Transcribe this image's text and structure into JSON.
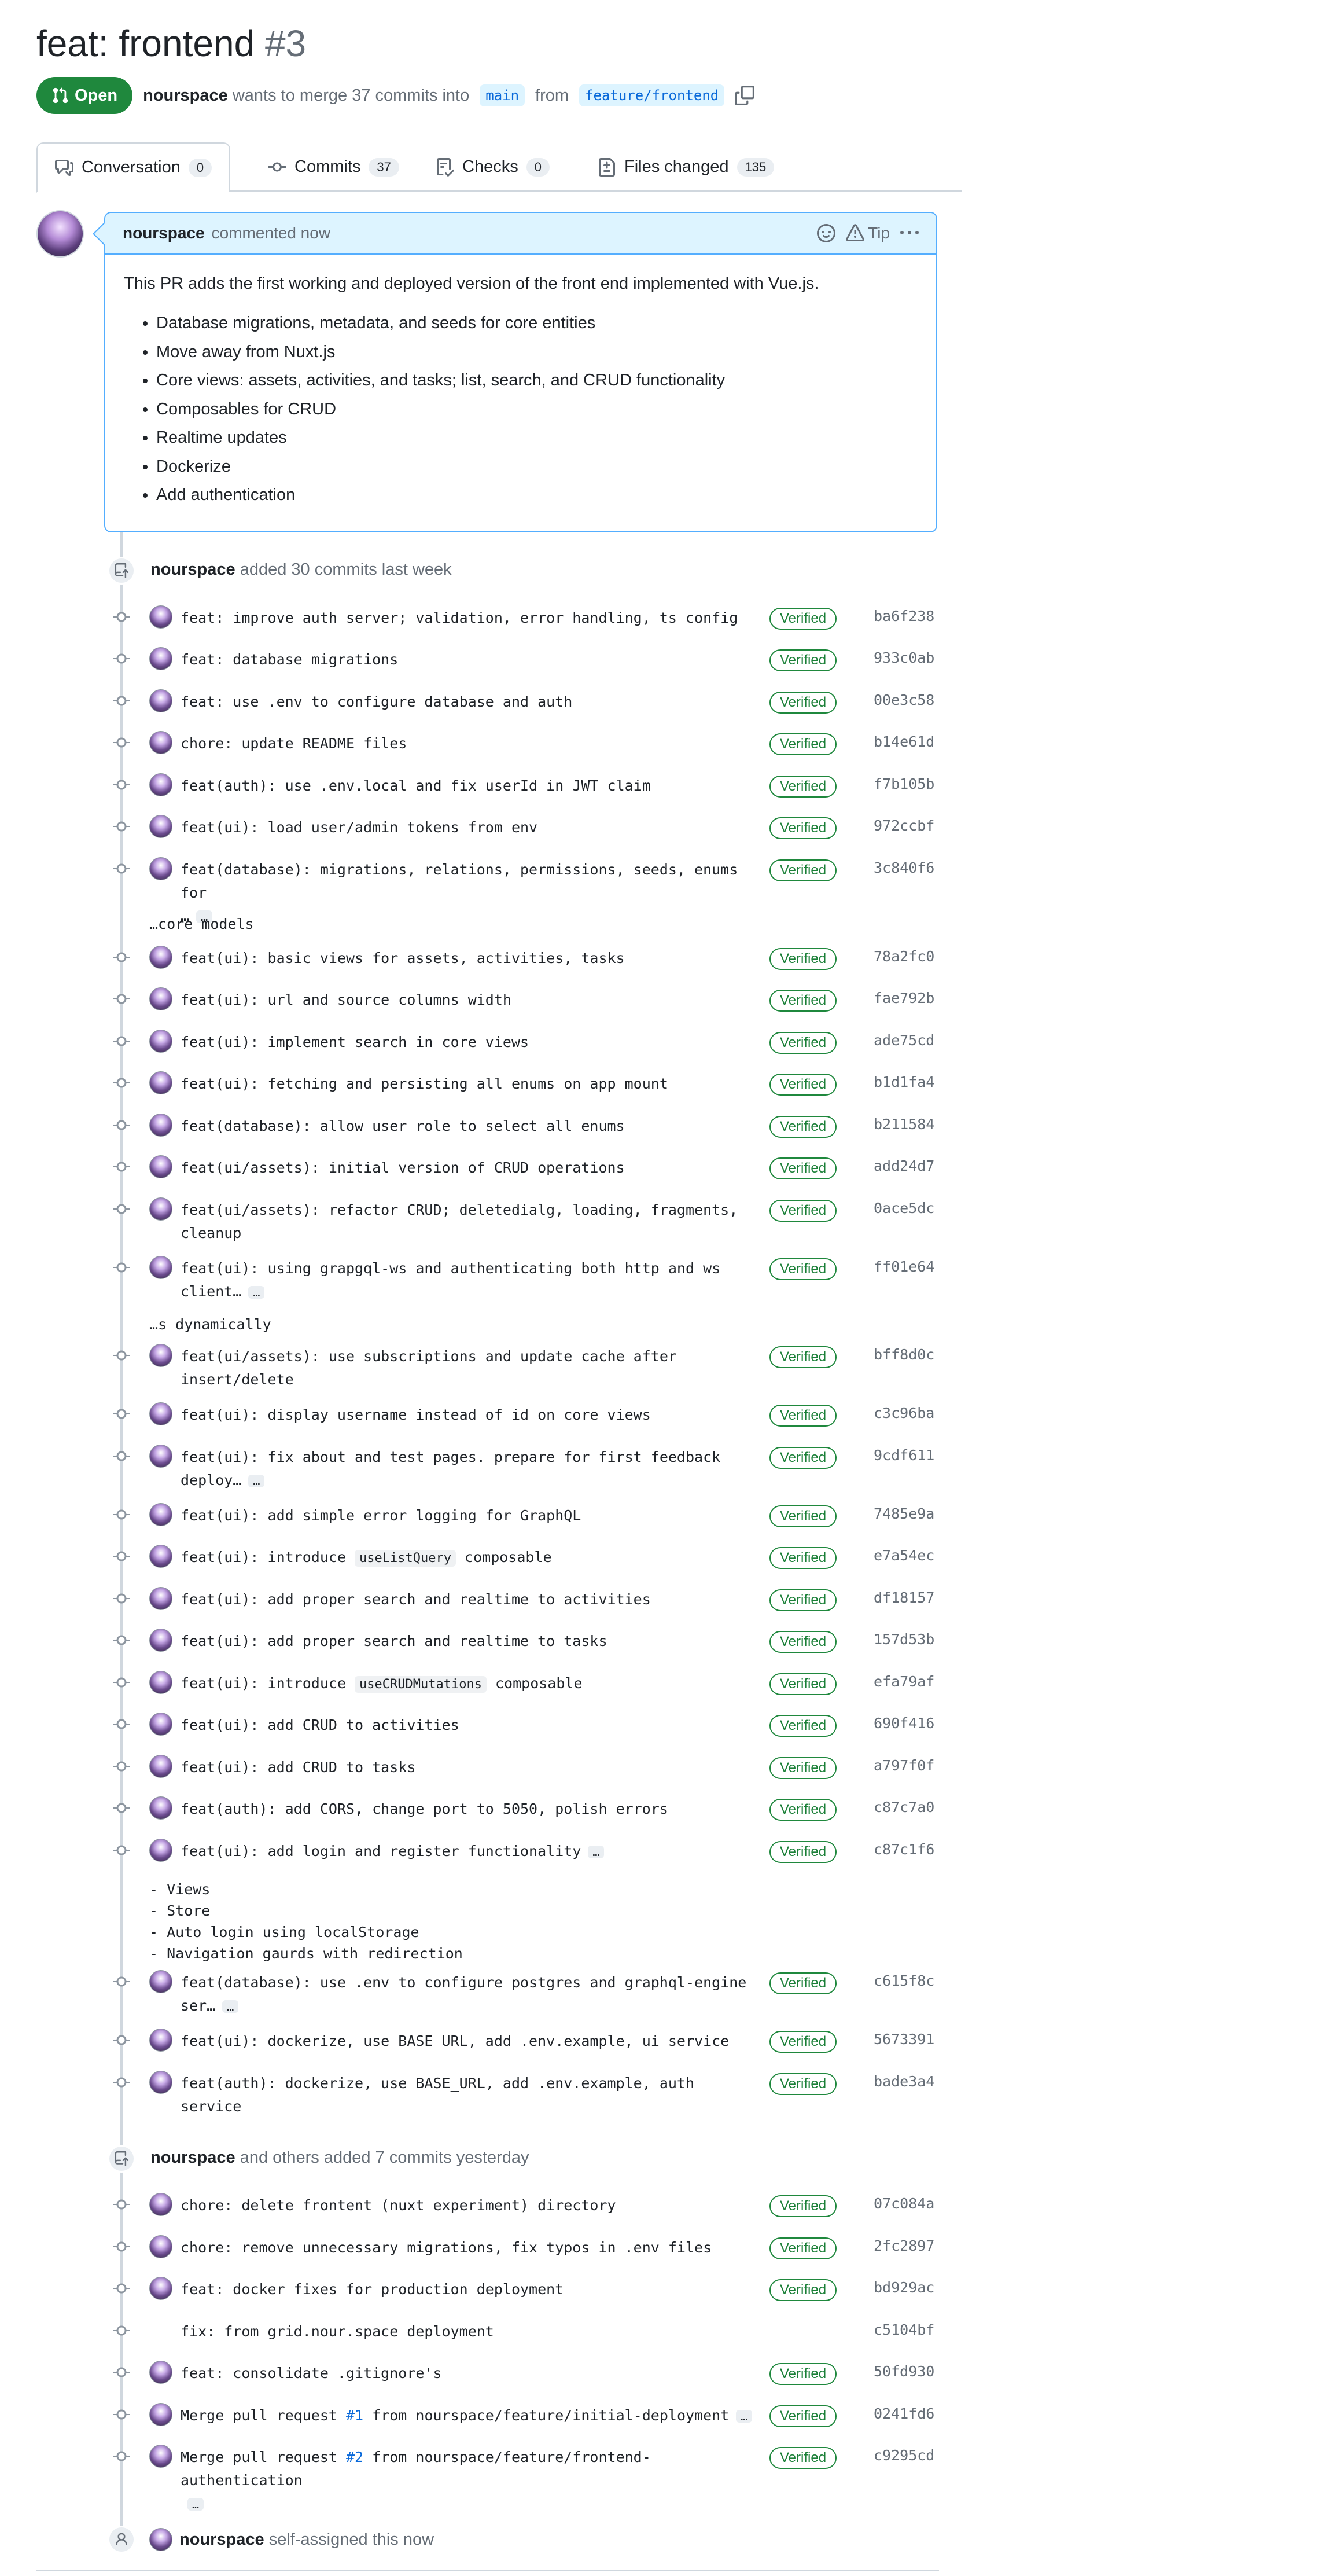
{
  "pr": {
    "title": "feat: frontend",
    "number": "#3",
    "state": "Open",
    "author": "nourspace",
    "merge_text": "wants to merge 37 commits into",
    "base_branch": "main",
    "from_text": "from",
    "head_branch": "feature/frontend"
  },
  "tabs": [
    {
      "label": "Conversation",
      "count": "0"
    },
    {
      "label": "Commits",
      "count": "37"
    },
    {
      "label": "Checks",
      "count": "0"
    },
    {
      "label": "Files changed",
      "count": "135"
    }
  ],
  "comment": {
    "author": "nourspace",
    "action": "commented now",
    "tip": "Tip",
    "intro": "This PR adds the first working and deployed version of the front end implemented with Vue.js.",
    "items": [
      "Database migrations, metadata, and seeds for core entities",
      "Move away from Nuxt.js",
      "Core views: assets, activities, and tasks; list, search, and CRUD functionality",
      "Composables for CRUD",
      "Realtime updates",
      "Dockerize",
      "Add authentication"
    ]
  },
  "group1": {
    "author": "nourspace",
    "text": "added 30 commits last week",
    "commits": [
      {
        "msg": "feat: improve auth server; validation, error handling, ts config",
        "sha": "ba6f238",
        "verified": "Verified"
      },
      {
        "msg": "feat: database migrations",
        "sha": "933c0ab",
        "verified": "Verified"
      },
      {
        "msg": "feat: use .env to configure database and auth",
        "sha": "00e3c58",
        "verified": "Verified"
      },
      {
        "msg": "chore: update README files",
        "sha": "b14e61d",
        "verified": "Verified"
      },
      {
        "msg": "feat(auth): use .env.local and fix userId in JWT claim",
        "sha": "f7b105b",
        "verified": "Verified"
      },
      {
        "msg": "feat(ui): load user/admin tokens from env",
        "sha": "972ccbf",
        "verified": "Verified"
      },
      {
        "msg": "feat(database): migrations, relations, permissions, seeds, enums for",
        "msg2": "…",
        "sha": "3c840f6",
        "verified": "Verified",
        "extra": "…core models"
      },
      {
        "msg": "feat(ui): basic views for assets, activities, tasks",
        "sha": "78a2fc0",
        "verified": "Verified"
      },
      {
        "msg": "feat(ui): url and source columns width",
        "sha": "fae792b",
        "verified": "Verified"
      },
      {
        "msg": "feat(ui): implement search in core views",
        "sha": "ade75cd",
        "verified": "Verified"
      },
      {
        "msg": "feat(ui): fetching and persisting all enums on app mount",
        "sha": "b1d1fa4",
        "verified": "Verified"
      },
      {
        "msg": "feat(database): allow user role to select all enums",
        "sha": "b211584",
        "verified": "Verified"
      },
      {
        "msg": "feat(ui/assets): initial version of CRUD operations",
        "sha": "add24d7",
        "verified": "Verified"
      },
      {
        "msg": "feat(ui/assets): refactor CRUD; deletedialg, loading, fragments,",
        "msg2": "cleanup",
        "sha": "0ace5dc",
        "verified": "Verified"
      },
      {
        "msg": "feat(ui): using grapgql-ws and authenticating both http and ws",
        "msg2": "client…",
        "sha": "ff01e64",
        "verified": "Verified",
        "extra": "…s dynamically"
      },
      {
        "msg": "feat(ui/assets): use subscriptions and update cache after",
        "msg2": "insert/delete",
        "sha": "bff8d0c",
        "verified": "Verified"
      },
      {
        "msg": "feat(ui): display username instead of id on core views",
        "sha": "c3c96ba",
        "verified": "Verified"
      },
      {
        "msg": "feat(ui): fix about and test pages. prepare for first feedback",
        "msg2": "deploy…",
        "sha": "9cdf611",
        "verified": "Verified"
      },
      {
        "msg": "feat(ui): add simple error logging for GraphQL",
        "sha": "7485e9a",
        "verified": "Verified"
      },
      {
        "msg_pre": "feat(ui): introduce ",
        "code": "useListQuery",
        "msg_post": " composable",
        "sha": "e7a54ec",
        "verified": "Verified"
      },
      {
        "msg": "feat(ui): add proper search and realtime to activities",
        "sha": "df18157",
        "verified": "Verified"
      },
      {
        "msg": "feat(ui): add proper search and realtime to tasks",
        "sha": "157d53b",
        "verified": "Verified"
      },
      {
        "msg_pre": "feat(ui): introduce ",
        "code": "useCRUDMutations",
        "msg_post": " composable",
        "sha": "efa79af",
        "verified": "Verified"
      },
      {
        "msg": "feat(ui): add CRUD to activities",
        "sha": "690f416",
        "verified": "Verified"
      },
      {
        "msg": "feat(ui): add CRUD to tasks",
        "sha": "a797f0f",
        "verified": "Verified"
      },
      {
        "msg": "feat(auth): add CORS, change port to 5050, polish errors",
        "sha": "c87c7a0",
        "verified": "Verified"
      },
      {
        "msg": "feat(ui): add login and register functionality",
        "sha": "c87c1f6",
        "verified": "Verified",
        "ellipsis_inline": true,
        "extra": "- Views\n- Store\n- Auto login using localStorage\n- Navigation gaurds with redirection"
      },
      {
        "msg": "feat(database): use .env to configure postgres and graphql-engine",
        "msg2": "ser…",
        "sha": "c615f8c",
        "verified": "Verified"
      },
      {
        "msg": "feat(ui): dockerize, use BASE_URL, add .env.example, ui service",
        "sha": "5673391",
        "verified": "Verified"
      },
      {
        "msg": "feat(auth): dockerize, use BASE_URL, add .env.example, auth service",
        "sha": "bade3a4",
        "verified": "Verified"
      }
    ]
  },
  "group2": {
    "author": "nourspace",
    "text": "and others added 7 commits yesterday",
    "commits": [
      {
        "msg": "chore: delete frontent (nuxt experiment) directory",
        "sha": "07c084a",
        "verified": "Verified"
      },
      {
        "msg": "chore: remove unnecessary migrations, fix typos in .env files",
        "sha": "2fc2897",
        "verified": "Verified"
      },
      {
        "msg": "feat: docker fixes for production deployment",
        "sha": "bd929ac",
        "verified": "Verified"
      },
      {
        "msg": "fix: from grid.nour.space deployment",
        "sha": "c5104bf",
        "verified": "",
        "no_avatar": true
      },
      {
        "msg": "feat: consolidate .gitignore's",
        "sha": "50fd930",
        "verified": "Verified"
      },
      {
        "msg_pre": "Merge pull request ",
        "link": "#1",
        "msg_post": " from nourspace/feature/initial-deployment",
        "sha": "0241fd6",
        "verified": "Verified",
        "ellipsis_inline": true
      },
      {
        "msg_pre": "Merge pull request ",
        "link": "#2",
        "msg_post": " from nourspace/feature/frontend-authentication",
        "msg2": "",
        "sha": "c9295cd",
        "verified": "Verified",
        "ellipsis_line2": true
      }
    ]
  },
  "assign_event": {
    "author": "nourspace",
    "text": "self-assigned this now"
  },
  "colors": {
    "accent": "#0969da",
    "open_green": "#1f883d",
    "verified_green": "#1a7f37",
    "comment_border": "#54aeff",
    "comment_header": "#ddf4ff"
  }
}
